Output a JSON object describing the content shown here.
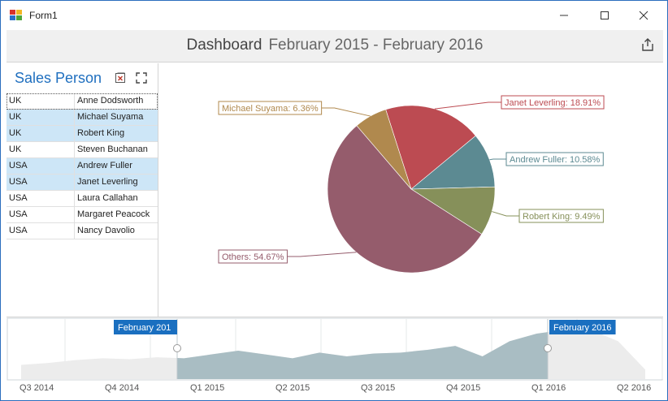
{
  "window": {
    "title": "Form1",
    "minimize_icon": "minimize-icon",
    "maximize_icon": "maximize-icon",
    "close_icon": "close-icon"
  },
  "header": {
    "title": "Dashboard",
    "period": "February 2015 - February 2016",
    "export_icon": "export-icon"
  },
  "sales_person": {
    "title": "Sales Person",
    "clear_icon": "clear-filter-icon",
    "maximize_icon": "fullscreen-icon",
    "rows": [
      {
        "country": "UK",
        "name": "Anne Dodsworth",
        "selected": false
      },
      {
        "country": "UK",
        "name": "Michael Suyama",
        "selected": true
      },
      {
        "country": "UK",
        "name": "Robert King",
        "selected": true
      },
      {
        "country": "UK",
        "name": "Steven Buchanan",
        "selected": false
      },
      {
        "country": "USA",
        "name": "Andrew Fuller",
        "selected": true
      },
      {
        "country": "USA",
        "name": "Janet Leverling",
        "selected": true
      },
      {
        "country": "USA",
        "name": "Laura Callahan",
        "selected": false
      },
      {
        "country": "USA",
        "name": "Margaret Peacock",
        "selected": false
      },
      {
        "country": "USA",
        "name": "Nancy Davolio",
        "selected": false
      }
    ]
  },
  "chart_data": [
    {
      "type": "pie",
      "slices": [
        {
          "label": "Janet Leverling: 18.91%",
          "name": "Janet Leverling",
          "value": 18.91,
          "color": "#bc4b52"
        },
        {
          "label": "Andrew Fuller: 10.58%",
          "name": "Andrew Fuller",
          "value": 10.58,
          "color": "#5c8a92"
        },
        {
          "label": "Robert King: 9.49%",
          "name": "Robert King",
          "value": 9.49,
          "color": "#86905a"
        },
        {
          "label": "Others: 54.67%",
          "name": "Others",
          "value": 54.67,
          "color": "#955c6c"
        },
        {
          "label": "Michael Suyama: 6.36%",
          "name": "Michael Suyama",
          "value": 6.36,
          "color": "#b0894e"
        }
      ]
    },
    {
      "type": "area",
      "categories": [
        "Q3 2014",
        "Q4 2014",
        "Q1 2015",
        "Q2 2015",
        "Q3 2015",
        "Q4 2015",
        "Q1 2016",
        "Q2 2016"
      ],
      "values": [
        15,
        17,
        20,
        22,
        21,
        23,
        22,
        26,
        30,
        26,
        22,
        28,
        24,
        27,
        28,
        31,
        35,
        24,
        40,
        48,
        52,
        52,
        40,
        10
      ],
      "selection": {
        "start": "February 201",
        "end": "February 2016"
      },
      "colors": {
        "selected": "#a9bdc3",
        "unselected": "#ececec"
      }
    }
  ]
}
